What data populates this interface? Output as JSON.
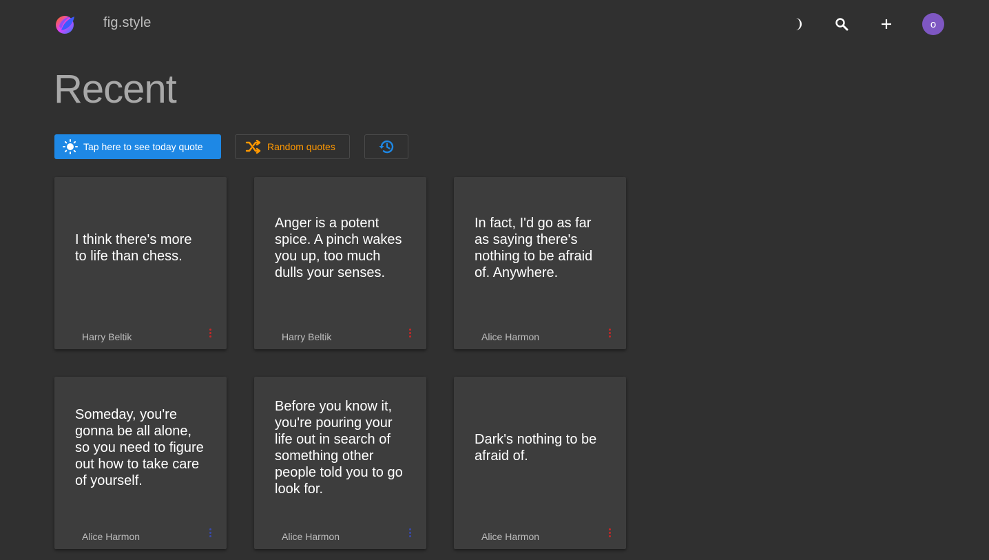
{
  "header": {
    "brand": "fig.style",
    "avatar_initial": "o",
    "icons": {
      "logo": "fig-logo",
      "theme": "moon-icon",
      "search": "search-icon",
      "add": "plus-icon"
    }
  },
  "page": {
    "title": "Recent"
  },
  "toolbar": {
    "today_label": "Tap here to see today quote",
    "random_label": "Random quotes",
    "colors": {
      "today_bg": "#1e88e5",
      "random_fg": "#ff9800",
      "history_fg": "#1e88e5"
    }
  },
  "quotes": [
    {
      "text": "I think there's more to life than chess.",
      "author": "Harry Beltik",
      "accent": "#c62828"
    },
    {
      "text": "Anger is a potent spice. A pinch wakes you up, too much dulls your senses.",
      "author": "Harry Beltik",
      "accent": "#c62828"
    },
    {
      "text": "In fact, I'd go as far as saying there's nothing to be afraid of. Anywhere.",
      "author": "Alice Harmon",
      "accent": "#c62828"
    },
    {
      "text": "Someday, you're gonna be all alone, so you need to figure out how to take care of yourself.",
      "author": "Alice Harmon",
      "accent": "#3949ab"
    },
    {
      "text": "Before you know it, you're pouring your life out in search of something other people told you to go look for.",
      "author": "Alice Harmon",
      "accent": "#3949ab"
    },
    {
      "text": "Dark's nothing to be afraid of.",
      "author": "Alice Harmon",
      "accent": "#c62828"
    }
  ]
}
